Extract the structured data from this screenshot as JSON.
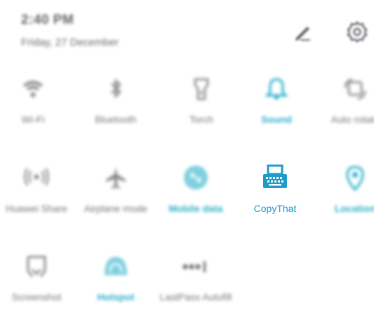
{
  "header": {
    "time": "2:40 PM",
    "date": "Friday, 27 December",
    "edit_icon": "pencil-edit-icon",
    "settings_icon": "gear-icon"
  },
  "tiles": [
    {
      "label": "Wi-Fi",
      "icon": "wifi-icon",
      "active": false
    },
    {
      "label": "Bluetooth",
      "icon": "bluetooth-icon",
      "active": false
    },
    {
      "label": "Torch",
      "icon": "torch-icon",
      "active": false
    },
    {
      "label": "Sound",
      "icon": "bell-icon",
      "active": true
    },
    {
      "label": "Auto rotate",
      "icon": "auto-rotate-icon",
      "active": false
    },
    {
      "label": "Huawei Share",
      "icon": "share-wave-icon",
      "active": false
    },
    {
      "label": "Airplane mode",
      "icon": "airplane-icon",
      "active": false
    },
    {
      "label": "Mobile data",
      "icon": "mobile-data-icon",
      "active": true
    },
    {
      "label": "CopyThat",
      "icon": "typewriter-icon",
      "active": true
    },
    {
      "label": "Location",
      "icon": "location-pin-icon",
      "active": true
    },
    {
      "label": "Screenshot",
      "icon": "screenshot-icon",
      "active": false
    },
    {
      "label": "Hotspot",
      "icon": "hotspot-icon",
      "active": true
    },
    {
      "label": "LastPass Autofill",
      "icon": "lastpass-dots-icon",
      "active": false
    }
  ],
  "colors": {
    "accent": "#2ab0c9",
    "copythat": "#1e9bc8",
    "inactive_icon": "#8a8a8a",
    "inactive_label": "#777777"
  }
}
